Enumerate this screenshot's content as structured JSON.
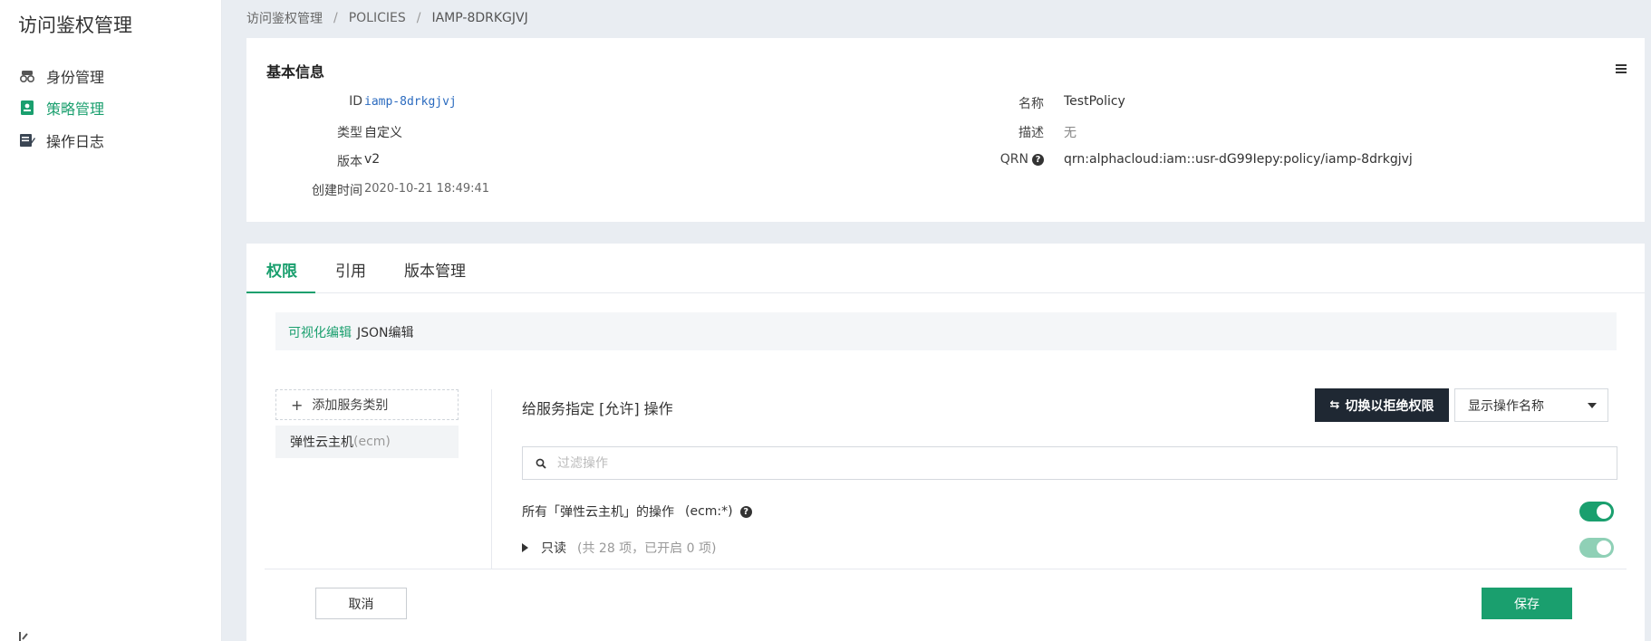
{
  "sidebar": {
    "app_title": "访问鉴权管理",
    "items": [
      {
        "label": "身份管理",
        "icon": "users-icon",
        "active": false
      },
      {
        "label": "策略管理",
        "icon": "policy-icon",
        "active": true
      },
      {
        "label": "操作日志",
        "icon": "log-icon",
        "active": false
      }
    ]
  },
  "breadcrumb": {
    "items": [
      "访问鉴权管理",
      "POLICIES",
      "IAMP-8DRKGJVJ"
    ],
    "separator": "/"
  },
  "basic_info": {
    "title": "基本信息",
    "fields": {
      "id": {
        "label": "ID",
        "value": "iamp-8drkgjvj"
      },
      "type": {
        "label": "类型",
        "value": "自定义"
      },
      "version": {
        "label": "版本",
        "value": "v2"
      },
      "created": {
        "label": "创建时间",
        "value": "2020-10-21 18:49:41"
      },
      "name": {
        "label": "名称",
        "value": "TestPolicy"
      },
      "description": {
        "label": "描述",
        "value": "无"
      },
      "qrn": {
        "label": "QRN",
        "value": "qrn:alphacloud:iam::usr-dG99Iepy:policy/iamp-8drkgjvj"
      }
    }
  },
  "tabs": [
    {
      "label": "权限",
      "active": true
    },
    {
      "label": "引用",
      "active": false
    },
    {
      "label": "版本管理",
      "active": false
    }
  ],
  "editor_modes": [
    {
      "label": "可视化编辑",
      "active": true
    },
    {
      "label": "JSON编辑",
      "active": false
    }
  ],
  "services": {
    "add_label": "添加服务类别",
    "items": [
      {
        "name": "弹性云主机",
        "code": "(ecm)"
      }
    ]
  },
  "permissions": {
    "title": "给服务指定 [允许] 操作",
    "deny_button": "切换以拒绝权限",
    "display_select": "显示操作名称",
    "filter_placeholder": "过滤操作",
    "all_row": {
      "label": "所有「弹性云主机」的操作",
      "code": "(ecm:*)",
      "enabled": true
    },
    "groups": [
      {
        "label": "只读",
        "meta": "(共 28 项，已开启 0 项)",
        "enabled": true
      }
    ]
  },
  "footer": {
    "cancel": "取消",
    "save": "保存"
  },
  "colors": {
    "accent": "#1a9f6e",
    "dark_button": "#1f2833",
    "link": "#2b6bbf"
  }
}
